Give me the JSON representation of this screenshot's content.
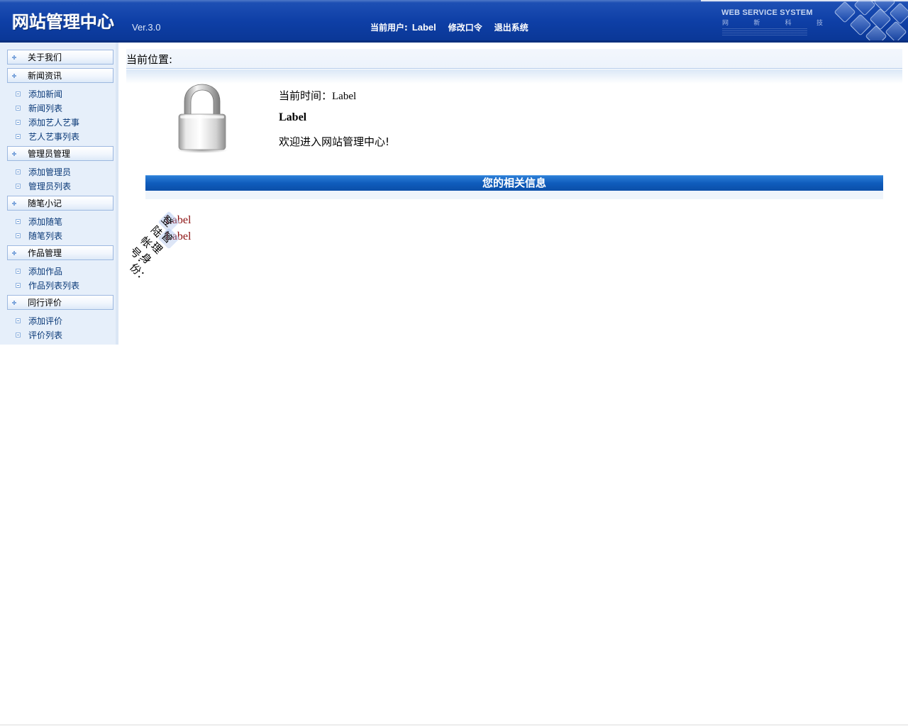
{
  "header": {
    "logo_text": "网站管理中心",
    "version": "Ver.3.0",
    "current_user_prefix": "当前用户:",
    "current_user": "Label",
    "change_password": "修改口令",
    "logout": "退出系统",
    "ws_title": "WEB SERVICE SYSTEM",
    "ws_sub": [
      "网",
      "新",
      "科",
      "技"
    ]
  },
  "sidebar": {
    "groups": [
      {
        "label": "关于我们",
        "items": []
      },
      {
        "label": "新闻资讯",
        "items": [
          "添加新闻",
          "新闻列表",
          "添加艺人艺事",
          "艺人艺事列表"
        ]
      },
      {
        "label": "管理员管理",
        "items": [
          "添加管理员",
          "管理员列表"
        ]
      },
      {
        "label": "随笔小记",
        "items": [
          "添加随笔",
          "随笔列表"
        ]
      },
      {
        "label": "作品管理",
        "items": [
          "添加作品",
          "作品列表列表"
        ]
      },
      {
        "label": "同行评价",
        "items": [
          "添加评价",
          "评价列表"
        ]
      }
    ]
  },
  "main": {
    "breadcrumb": "当前位置:",
    "time_prefix": "当前时间：",
    "time_value": "Label",
    "user_name": "Label",
    "welcome": "欢迎进入网站管理中心!",
    "info_title": "您的相关信息",
    "account_label": "登陆帐号：",
    "account_value": "Label",
    "role_label": "管理身份：",
    "role_value": "Label"
  },
  "colors": {
    "header_blue": "#0e3fa6",
    "sidebar_bg": "#e6effa",
    "info_bar": "#0f5cbc",
    "value_red": "#8b1010"
  },
  "icons": {
    "main_image": "lock-icon",
    "group_toggle": "plus-icon",
    "sub_item": "minus-box-icon"
  }
}
